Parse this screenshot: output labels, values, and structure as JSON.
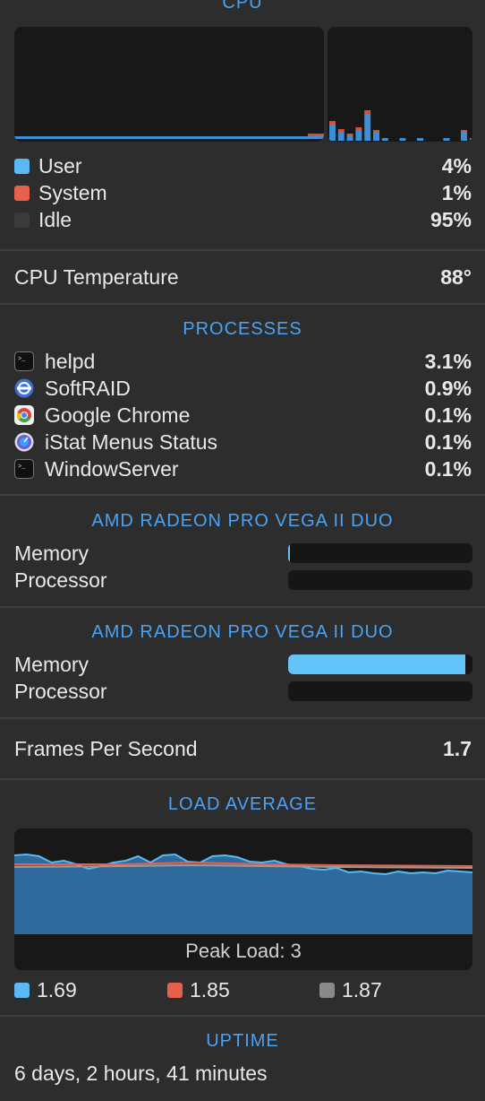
{
  "cpu": {
    "title": "CPU",
    "legend": [
      {
        "label": "User",
        "value": "4%",
        "color": "#5ab8f5"
      },
      {
        "label": "System",
        "value": "1%",
        "color": "#e8604c"
      },
      {
        "label": "Idle",
        "value": "95%",
        "color": "#3a3a3a"
      }
    ],
    "temperature_label": "CPU Temperature",
    "temperature_value": "88°"
  },
  "processes": {
    "title": "PROCESSES",
    "items": [
      {
        "name": "helpd",
        "value": "3.1%",
        "icon": "terminal-icon"
      },
      {
        "name": "SoftRAID",
        "value": "0.9%",
        "icon": "softraid-icon"
      },
      {
        "name": "Google Chrome",
        "value": "0.1%",
        "icon": "chrome-icon"
      },
      {
        "name": "iStat Menus Status",
        "value": "0.1%",
        "icon": "istat-icon"
      },
      {
        "name": "WindowServer",
        "value": "0.1%",
        "icon": "terminal-icon"
      }
    ]
  },
  "gpus": [
    {
      "title": "AMD RADEON PRO VEGA II DUO",
      "memory_label": "Memory",
      "memory_level": 0.01,
      "processor_label": "Processor",
      "processor_level": 0
    },
    {
      "title": "AMD RADEON PRO VEGA II DUO",
      "memory_label": "Memory",
      "memory_level": 0.96,
      "processor_label": "Processor",
      "processor_level": 0
    }
  ],
  "fps": {
    "label": "Frames Per Second",
    "value": "1.7"
  },
  "load": {
    "title": "LOAD AVERAGE",
    "peak": "Peak Load: 3",
    "values": [
      {
        "value": "1.69",
        "color": "#5ab8f5"
      },
      {
        "value": "1.85",
        "color": "#e8604c"
      },
      {
        "value": "1.87",
        "color": "#8a8a8a"
      }
    ]
  },
  "uptime": {
    "title": "UPTIME",
    "value": "6 days, 2 hours, 41 minutes"
  }
}
